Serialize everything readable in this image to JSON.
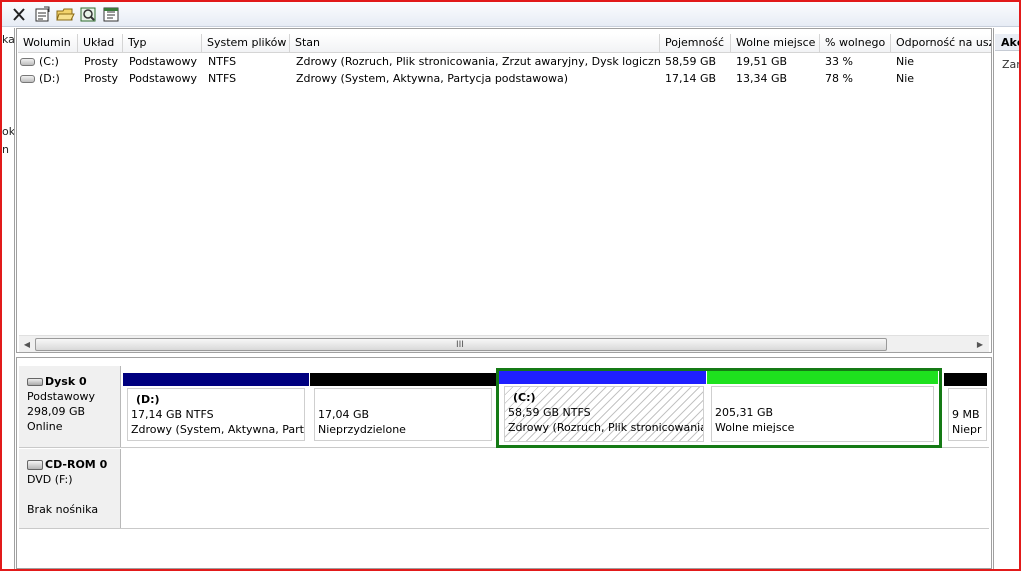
{
  "toolbar": {
    "buttons": [
      "delete-icon",
      "properties-icon",
      "open-folder-icon",
      "explore-icon",
      "help-icon"
    ]
  },
  "left_strip": {
    "fragments": [
      "ka",
      "ok",
      "n"
    ]
  },
  "actions_pane": {
    "title": "Akc",
    "item": "Zar"
  },
  "volume_list": {
    "columns": [
      "Wolumin",
      "Układ",
      "Typ",
      "System plików",
      "Stan",
      "Pojemność",
      "Wolne miejsce",
      "% wolnego",
      "Odporność na usz"
    ],
    "rows": [
      {
        "volume": "(C:)",
        "layout": "Prosty",
        "type": "Podstawowy",
        "fs": "NTFS",
        "status": "Zdrowy (Rozruch, Plik stronicowania, Zrzut awaryjny, Dysk logiczny)",
        "capacity": "58,59 GB",
        "free": "19,51 GB",
        "pct_free": "33 %",
        "fault": "Nie"
      },
      {
        "volume": "(D:)",
        "layout": "Prosty",
        "type": "Podstawowy",
        "fs": "NTFS",
        "status": "Zdrowy (System, Aktywna, Partycja podstawowa)",
        "capacity": "17,14 GB",
        "free": "13,34 GB",
        "pct_free": "78 %",
        "fault": "Nie"
      }
    ],
    "scroll_grip": "III"
  },
  "disks": {
    "disk0": {
      "name": "Dysk 0",
      "type": "Podstawowy",
      "size": "298,09 GB",
      "state": "Online",
      "partitions": [
        {
          "title": "(D:)",
          "size": "17,14 GB NTFS",
          "status": "Zdrowy (System, Aktywna, Party",
          "bar_color": "#00007f"
        },
        {
          "title": "",
          "size": "17,04 GB",
          "status": "Nieprzydzielone",
          "bar_color": "#000000"
        },
        {
          "title": "(C:)",
          "size": "58,59 GB NTFS",
          "status": "Zdrowy (Rozruch, Plik stronicowania",
          "bar_color": "#1f1fff"
        },
        {
          "title": "",
          "size": "205,31 GB",
          "status": "Wolne miejsce",
          "bar_color": "#1ee11e"
        },
        {
          "title": "",
          "size": "9 MB",
          "status": "Niepr",
          "bar_color": "#000000"
        }
      ]
    },
    "cdrom0": {
      "name": "CD-ROM 0",
      "type": "DVD (F:)",
      "state": "Brak nośnika"
    }
  },
  "colors": {
    "frame": "#e21a1a",
    "selection": "#157a15"
  }
}
